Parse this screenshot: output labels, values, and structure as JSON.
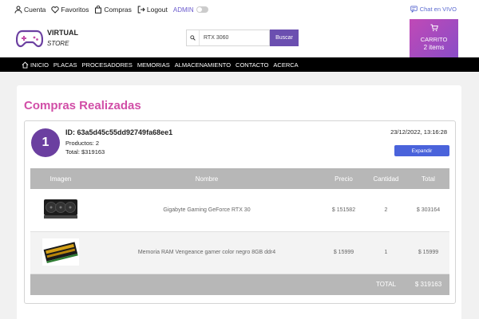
{
  "topbar": {
    "account": "Cuenta",
    "favorites": "Favoritos",
    "purchases": "Compras",
    "logout": "Logout",
    "admin": "ADMIN",
    "chat": "Chat en VIVO"
  },
  "header": {
    "brand_name": "VIRTUAL",
    "brand_sub": "STORE",
    "search_value": "RTX 3060",
    "search_button": "Buscar",
    "cart_label": "CARRITO",
    "cart_count": "2 items"
  },
  "nav": {
    "items": [
      "INICIO",
      "PLACAS",
      "PROCESADORES",
      "MEMORIAS",
      "ALMACENAMIENTO",
      "CONTACTO",
      "ACERCA"
    ]
  },
  "main": {
    "title": "Compras Realizadas",
    "order": {
      "number": "1",
      "id": "ID: 63a5d45c55dd92749fa68ee1",
      "products": "Productos: 2",
      "total": "Total: $319163",
      "date": "23/12/2022, 13:16:28",
      "expand_button": "Expandir"
    },
    "table": {
      "headers": [
        "Imagen",
        "Nombre",
        "Precio",
        "Cantidad",
        "Total"
      ],
      "rows": [
        {
          "name": "Gigabyte Gaming GeForce RTX 30",
          "price": "$ 151582",
          "qty": "2",
          "total": "$ 303164"
        },
        {
          "name": "Memoria RAM Vengeance gamer color negro 8GB ddr4",
          "price": "$ 15999",
          "qty": "1",
          "total": "$ 15999"
        }
      ],
      "footer_label": "TOTAL",
      "footer_total": "$ 319163"
    }
  },
  "colors": {
    "title_pink": "#d14ea7",
    "badge_purple": "#6b3fa0",
    "expand_blue": "#4a63db",
    "search_button": "#6b4fb0"
  }
}
